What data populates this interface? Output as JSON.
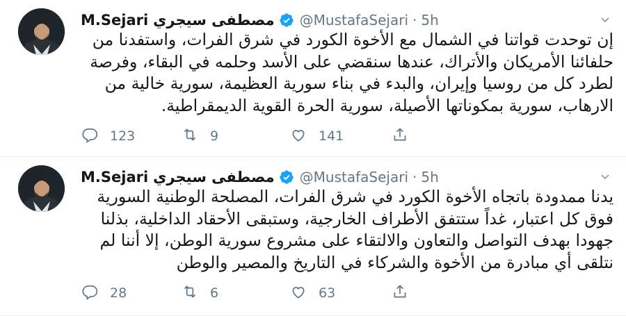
{
  "tweets": [
    {
      "name_latin": "M.Sejari",
      "name_arabic": "مصطفى سيجري",
      "handle": "@MustafaSejari",
      "separator": "·",
      "time": "5h",
      "text": "إن توحدت قواتنا في الشمال مع الأخوة الكورد في شرق الفرات، واستفدنا من حلفائنا الأمريكان والأتراك، عندها سنقضي على الأسد وحلمه في البقاء، وفرصة لطرد كل من روسيا وإيران، والبدء في بناء سورية العظيمة، سورية خالية من الارهاب، سورية بمكوناتها الأصيلة، سورية الحرة القوية الديمقراطية.",
      "replies": "123",
      "retweets": "9",
      "likes": "141"
    },
    {
      "name_latin": "M.Sejari",
      "name_arabic": "مصطفى سيجري",
      "handle": "@MustafaSejari",
      "separator": "·",
      "time": "5h",
      "text": "يدنا ممدودة باتجاه الأخوة الكورد في شرق الفرات، المصلحة الوطنية السورية فوق كل اعتبار، غداً ستتفق الأطراف الخارجية، وستبقى الأحقاد الداخلية، بذلنا جهودا بهدف التواصل والتعاون والالتقاء على مشروع سورية الوطن، إلا أننا لم نتلقى أي مبادرة من الأخوة والشركاء في التاريخ والمصير والوطن",
      "replies": "28",
      "retweets": "6",
      "likes": "63"
    }
  ],
  "icons": {
    "verified": "verified-badge-icon",
    "more": "chevron-down-icon",
    "reply": "reply-icon",
    "retweet": "retweet-icon",
    "like": "heart-icon",
    "share": "share-icon"
  },
  "colors": {
    "text": "#14171a",
    "muted": "#657786",
    "verified": "#1da1f2",
    "divider": "#e6ecf0"
  }
}
